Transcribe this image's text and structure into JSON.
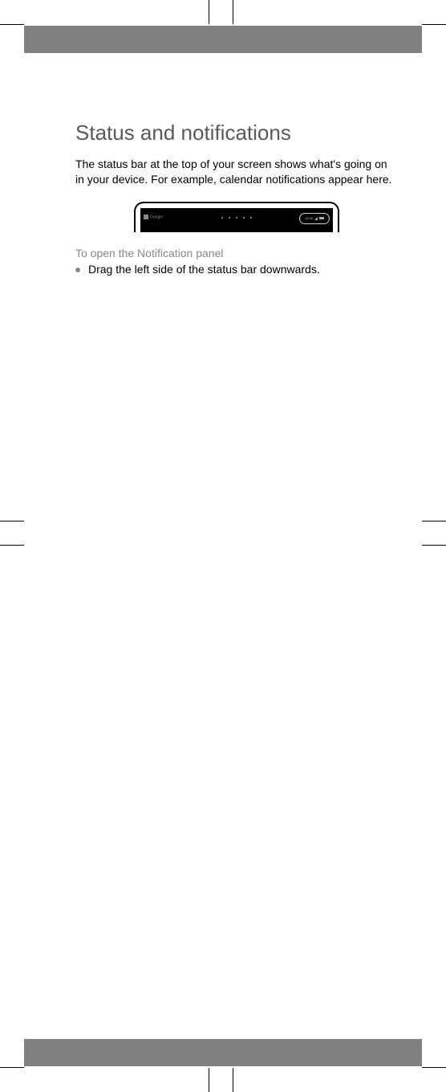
{
  "heading": "Status and notifications",
  "body_text": "The status bar at the top of your screen shows what's going on in your device. For example, calendar notifications appear here.",
  "subheading": "To open the Notification panel",
  "bullet_text": "Drag the left side of the status bar downwards.",
  "phone": {
    "left_label": "Google",
    "time": "12:00"
  }
}
